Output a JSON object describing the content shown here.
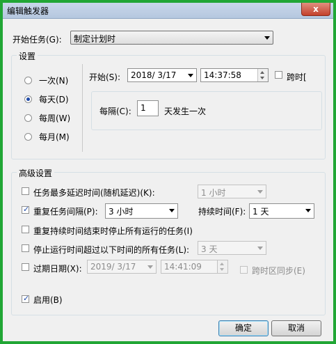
{
  "title": "编辑触发器",
  "close_glyph": "x",
  "begin_task": {
    "label": "开始任务(G):",
    "value": "制定计划时"
  },
  "settings": {
    "title": "设置",
    "radios": [
      {
        "label": "一次(N)",
        "checked": false
      },
      {
        "label": "每天(D)",
        "checked": true
      },
      {
        "label": "每周(W)",
        "checked": false
      },
      {
        "label": "每月(M)",
        "checked": false
      }
    ],
    "start_label": "开始(S):",
    "start_date": "2018/  3/17",
    "start_time": "14:37:58",
    "sync_label": "跨时[",
    "recur_label": "每隔(C):",
    "recur_value": "1",
    "recur_suffix": "天发生一次"
  },
  "advanced": {
    "title": "高级设置",
    "delay_label": "任务最多延迟时间(随机延迟)(K):",
    "delay_value": "1 小时",
    "repeat_label": "重复任务间隔(P):",
    "repeat_value": "3 小时",
    "duration_label": "持续时间(F):",
    "duration_value": "1 天",
    "stop_all_label": "重复持续时间结束时停止所有运行的任务(I)",
    "stop_longer_label": "停止运行时间超过以下时间的所有任务(L):",
    "stop_longer_value": "3 天",
    "expire_label": "过期日期(X):",
    "expire_date": "2019/  3/17",
    "expire_time": "14:41:09",
    "expire_sync_label": "跨时区同步(E)",
    "enabled_label": "启用(B)"
  },
  "buttons": {
    "ok": "确定",
    "cancel": "取消"
  },
  "check_glyph": "✓"
}
